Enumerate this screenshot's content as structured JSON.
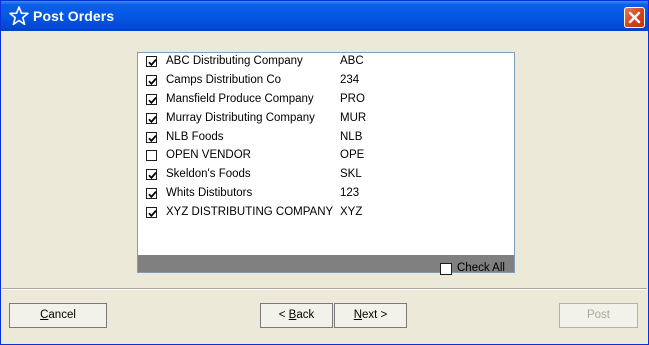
{
  "window": {
    "title": "Post Orders",
    "icon": "star-outline-icon",
    "close_icon": "close-x-icon"
  },
  "vendors": [
    {
      "name": "ABC Distributing Company",
      "code": "ABC",
      "checked": true
    },
    {
      "name": "Camps Distribution Co",
      "code": "234",
      "checked": true
    },
    {
      "name": "Mansfield Produce Company",
      "code": "PRO",
      "checked": true
    },
    {
      "name": "Murray Distributing Company",
      "code": "MUR",
      "checked": true
    },
    {
      "name": "NLB Foods",
      "code": "NLB",
      "checked": true
    },
    {
      "name": "OPEN VENDOR",
      "code": "OPE",
      "checked": false
    },
    {
      "name": "Skeldon's Foods",
      "code": "SKL",
      "checked": true
    },
    {
      "name": "Whits Distibutors",
      "code": "123",
      "checked": true
    },
    {
      "name": "XYZ DISTRIBUTING COMPANY",
      "code": "XYZ",
      "checked": true
    }
  ],
  "check_all": {
    "label": "Check All",
    "checked": false
  },
  "buttons": {
    "cancel_mnemonic": "C",
    "cancel_rest": "ancel",
    "back_prefix": "< ",
    "back_mnemonic": "B",
    "back_rest": "ack",
    "next_mnemonic": "N",
    "next_rest": "ext >",
    "post": "Post",
    "post_enabled": false
  }
}
